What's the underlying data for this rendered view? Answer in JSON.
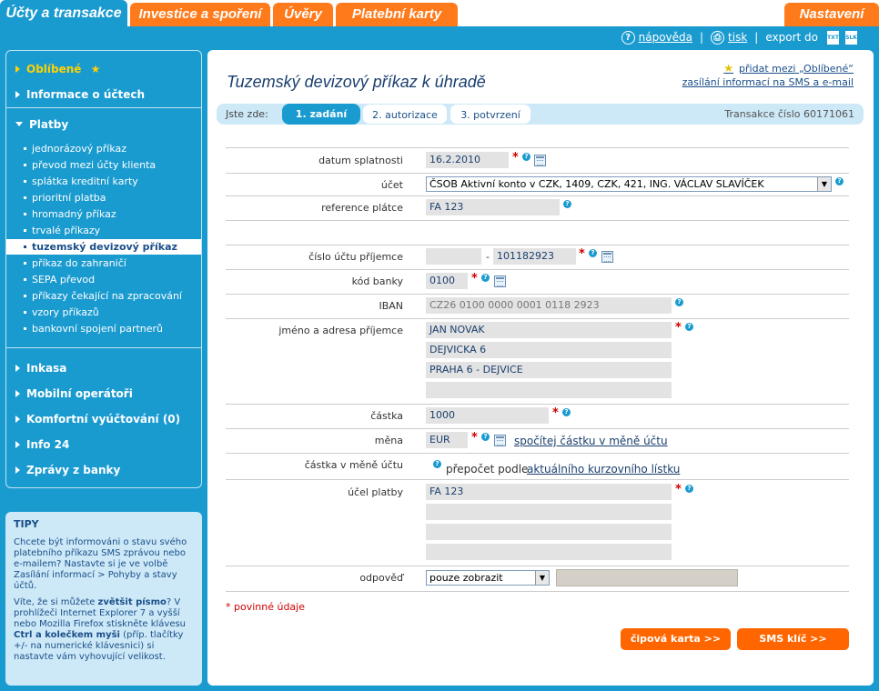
{
  "top_tabs": [
    "Účty a transakce",
    "Investice a spoření",
    "Úvěry",
    "Platební karty"
  ],
  "settings_tab": "Nastavení",
  "tools": {
    "help": "nápověda",
    "print": "tisk",
    "export": "export do",
    "export_txt": "TXT",
    "export_slk": "SLK"
  },
  "sidebar": {
    "favorites": "Oblíbené",
    "account_info": "Informace o účtech",
    "payments": "Platby",
    "payment_items": [
      "jednorázový příkaz",
      "převod mezi účty klienta",
      "splátka kreditní karty",
      "prioritní platba",
      "hromadný příkaz",
      "trvalé příkazy",
      "tuzemský devizový příkaz",
      "příkaz do zahraničí",
      "SEPA převod",
      "příkazy čekající na zpracování",
      "vzory příkazů",
      "bankovní spojení partnerů"
    ],
    "sections": [
      "Inkasa",
      "Mobilní operátoři",
      "Komfortní vyúčtování (0)",
      "Info 24",
      "Zprávy z banky"
    ]
  },
  "tips": {
    "title": "TIPY",
    "p1": "Chcete být informováni o stavu svého platebního příkazu SMS zprávou nebo e-mailem? Nastavte si je ve volbě Zasílání informací > Pohyby a stavy účtů.",
    "p2a": "Víte, že si můžete ",
    "p2b": "zvětšit písmo",
    "p2c": "? V prohlížeči Internet Explorer 7 a vyšší nebo Mozilla Firefox stiskněte klávesu ",
    "p2d": "Ctrl a kolečkem myši",
    "p2e": " (příp. tlačítky +/- na numerické klávesnici) si nastavte vám vyhovující velikost."
  },
  "main": {
    "title": "Tuzemský devizový příkaz k úhradě",
    "fav_link": "přidat mezi „Oblíbené“",
    "sms_link": "zasílání informací na SMS a e-mail",
    "here": "Jste zde:",
    "steps": [
      "1. zadání",
      "2. autorizace",
      "3. potvrzení"
    ],
    "transaction": "Transakce číslo 60171061"
  },
  "form": {
    "due_date_label": "datum splatnosti",
    "due_date": "16.2.2010",
    "account_label": "účet",
    "account": "ČSOB Aktivní konto v CZK, 1409, CZK, 421, ING. VÁCLAV SLAVÍČEK",
    "payer_ref_label": "reference plátce",
    "payer_ref": "FA 123",
    "recipient_account_label": "číslo účtu příjemce",
    "recipient_prefix": "",
    "recipient_account": "101182923",
    "bank_code_label": "kód banky",
    "bank_code": "0100",
    "iban_label": "IBAN",
    "iban": "CZ26 0100 0000 0001 0118 2923",
    "recipient_name_label": "jméno a adresa příjemce",
    "recipient_lines": [
      "JAN NOVAK",
      "DEJVICKA 6",
      "PRAHA 6 - DEJVICE",
      ""
    ],
    "amount_label": "částka",
    "amount": "1000",
    "currency_label": "měna",
    "currency": "EUR",
    "calc_link": "spočítej částku v měně účtu",
    "amount_in_account_label": "částka v měně účtu",
    "conversion_text": "přepočet podle",
    "rate_link": "aktuálního kurzovního lístku",
    "purpose_label": "účel platby",
    "purpose_lines": [
      "FA 123",
      "",
      "",
      ""
    ],
    "response_label": "odpověď",
    "response": "pouze zobrazit"
  },
  "mandatory": "* povinné údaje",
  "buttons": {
    "chip_card": "čipová karta >>",
    "sms_key": "SMS klíč >>"
  },
  "colors": {
    "brand_blue": "#1a9bd0",
    "orange": "#ff7a1a",
    "dark_blue": "#1a3f6e",
    "required_red": "#cc0000"
  }
}
